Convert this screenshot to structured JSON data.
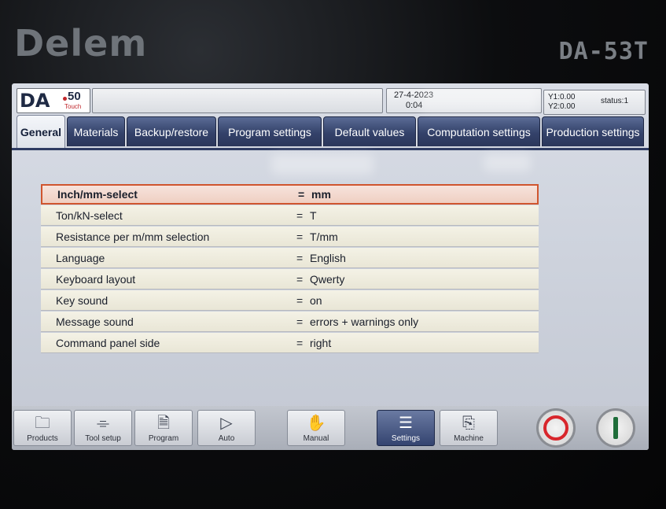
{
  "device": {
    "brand": "Delem",
    "model": "DA-53T"
  },
  "statusbar": {
    "logo_text": "DA",
    "logo_number": "50",
    "logo_sub": "Touch",
    "message": "",
    "date": "27-4-2023",
    "time": "0:04",
    "y1": "Y1:0.00",
    "y2": "Y2:0.00",
    "status": "status:1"
  },
  "tabs": [
    {
      "label": "General",
      "active": true
    },
    {
      "label": "Materials",
      "active": false
    },
    {
      "label": "Backup/restore",
      "active": false
    },
    {
      "label": "Program settings",
      "active": false
    },
    {
      "label": "Default values",
      "active": false
    },
    {
      "label": "Computation settings",
      "active": false
    },
    {
      "label": "Production settings",
      "active": false
    }
  ],
  "settings": {
    "equals": "=",
    "rows": [
      {
        "label": "Inch/mm-select",
        "value": "mm",
        "selected": true
      },
      {
        "label": "Ton/kN-select",
        "value": "T",
        "selected": false
      },
      {
        "label": "Resistance per m/mm selection",
        "value": "T/mm",
        "selected": false
      },
      {
        "label": "Language",
        "value": "English",
        "selected": false
      },
      {
        "label": "Keyboard layout",
        "value": "Qwerty",
        "selected": false
      },
      {
        "label": "Key sound",
        "value": "on",
        "selected": false
      },
      {
        "label": "Message sound",
        "value": "errors + warnings only",
        "selected": false
      },
      {
        "label": "Command panel side",
        "value": "right",
        "selected": false
      }
    ]
  },
  "toolbar": {
    "products": "Products",
    "tool_setup": "Tool setup",
    "program": "Program",
    "auto": "Auto",
    "manual": "Manual",
    "settings": "Settings",
    "machine": "Machine"
  },
  "colors": {
    "tab_bg": "#34426a",
    "selected_row_border": "#d0552e",
    "stop_red": "#d8262c",
    "start_green": "#1f6d3a"
  }
}
